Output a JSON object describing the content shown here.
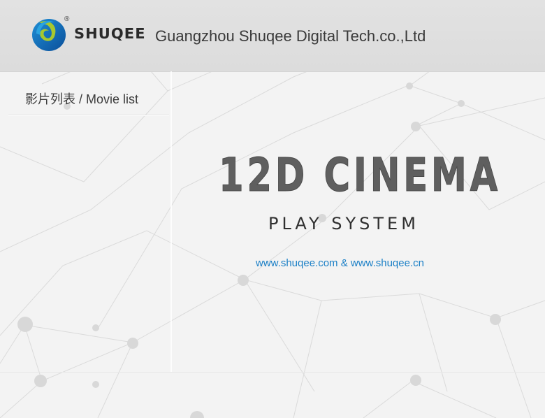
{
  "app": {
    "brand_name": "SHUQEE",
    "registered_mark": "®",
    "company_name": "Guangzhou Shuqee Digital Tech.co.,Ltd"
  },
  "sidebar": {
    "title": "影片列表  / Movie list"
  },
  "main": {
    "product_title": "12D CINEMA",
    "product_subtitle": "PLAY SYSTEM",
    "website": "www.shuqee.com & www.shuqee.cn"
  },
  "colors": {
    "header_bg": "#dcdcdc",
    "link": "#1a7fc6",
    "title": "#5a5a5a"
  }
}
